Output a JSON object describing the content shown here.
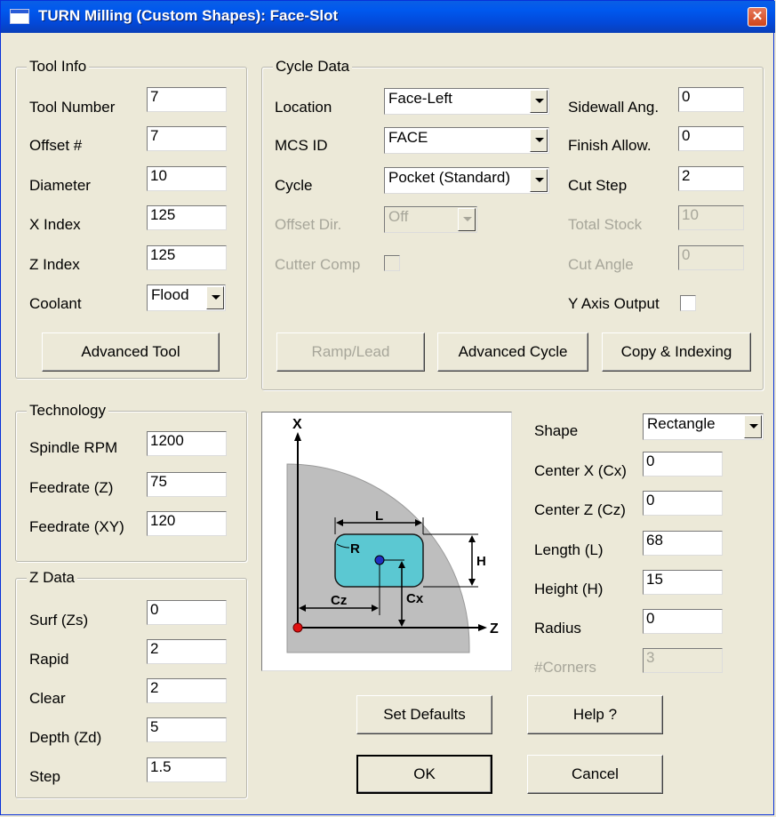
{
  "window": {
    "title": "TURN Milling (Custom Shapes): Face-Slot",
    "close_symbol": "✕"
  },
  "tool_info": {
    "legend": "Tool Info",
    "tool_number": {
      "label": "Tool Number",
      "value": "7"
    },
    "offset": {
      "label": "Offset #",
      "value": "7"
    },
    "diameter": {
      "label": "Diameter",
      "value": "10"
    },
    "x_index": {
      "label": "X Index",
      "value": "125"
    },
    "z_index": {
      "label": "Z Index",
      "value": "125"
    },
    "coolant": {
      "label": "Coolant",
      "value": "Flood"
    },
    "advanced_tool_button": "Advanced Tool"
  },
  "cycle_data": {
    "legend": "Cycle Data",
    "location": {
      "label": "Location",
      "value": "Face-Left"
    },
    "mcs_id": {
      "label": "MCS ID",
      "value": "FACE"
    },
    "cycle": {
      "label": "Cycle",
      "value": "Pocket (Standard)"
    },
    "offset_dir": {
      "label": "Offset Dir.",
      "value": "Off"
    },
    "cutter_comp": {
      "label": "Cutter Comp"
    },
    "sidewall_ang": {
      "label": "Sidewall Ang.",
      "value": "0"
    },
    "finish_allow": {
      "label": "Finish Allow.",
      "value": "0"
    },
    "cut_step": {
      "label": "Cut Step",
      "value": "2"
    },
    "total_stock": {
      "label": "Total Stock",
      "value": "10"
    },
    "cut_angle": {
      "label": "Cut Angle",
      "value": "0"
    },
    "y_axis_output": {
      "label": "Y Axis Output"
    },
    "ramp_lead_button": "Ramp/Lead",
    "advanced_cycle_button": "Advanced Cycle",
    "copy_indexing_button": "Copy & Indexing"
  },
  "technology": {
    "legend": "Technology",
    "spindle_rpm": {
      "label": "Spindle RPM",
      "value": "1200"
    },
    "feedrate_z": {
      "label": "Feedrate (Z)",
      "value": "75"
    },
    "feedrate_xy": {
      "label": "Feedrate (XY)",
      "value": "120"
    }
  },
  "z_data": {
    "legend": "Z Data",
    "surf": {
      "label": "Surf (Zs)",
      "value": "0"
    },
    "rapid": {
      "label": "Rapid",
      "value": "2"
    },
    "clear": {
      "label": "Clear",
      "value": "2"
    },
    "depth": {
      "label": "Depth (Zd)",
      "value": "5"
    },
    "step": {
      "label": "Step",
      "value": "1.5"
    }
  },
  "diagram": {
    "x_axis": "X",
    "z_axis": "Z",
    "length": "L",
    "height": "H",
    "radius": "R",
    "center_z": "Cz",
    "center_x": "Cx"
  },
  "shape": {
    "shape": {
      "label": "Shape",
      "value": "Rectangle"
    },
    "center_x": {
      "label": "Center X (Cx)",
      "value": "0"
    },
    "center_z": {
      "label": "Center Z (Cz)",
      "value": "0"
    },
    "length": {
      "label": "Length (L)",
      "value": "68"
    },
    "height": {
      "label": "Height (H)",
      "value": "15"
    },
    "radius": {
      "label": "Radius",
      "value": "0"
    },
    "corners": {
      "label": "#Corners",
      "value": "3"
    }
  },
  "footer": {
    "set_defaults_button": "Set Defaults",
    "help_button": "Help ?",
    "ok_button": "OK",
    "cancel_button": "Cancel"
  },
  "colors": {
    "title_bar": "#0058EE",
    "face_pocket": "#5BC8D2",
    "part_gray": "#BEBEBE",
    "origin_red": "#E01010",
    "center_blue": "#2030C0"
  }
}
